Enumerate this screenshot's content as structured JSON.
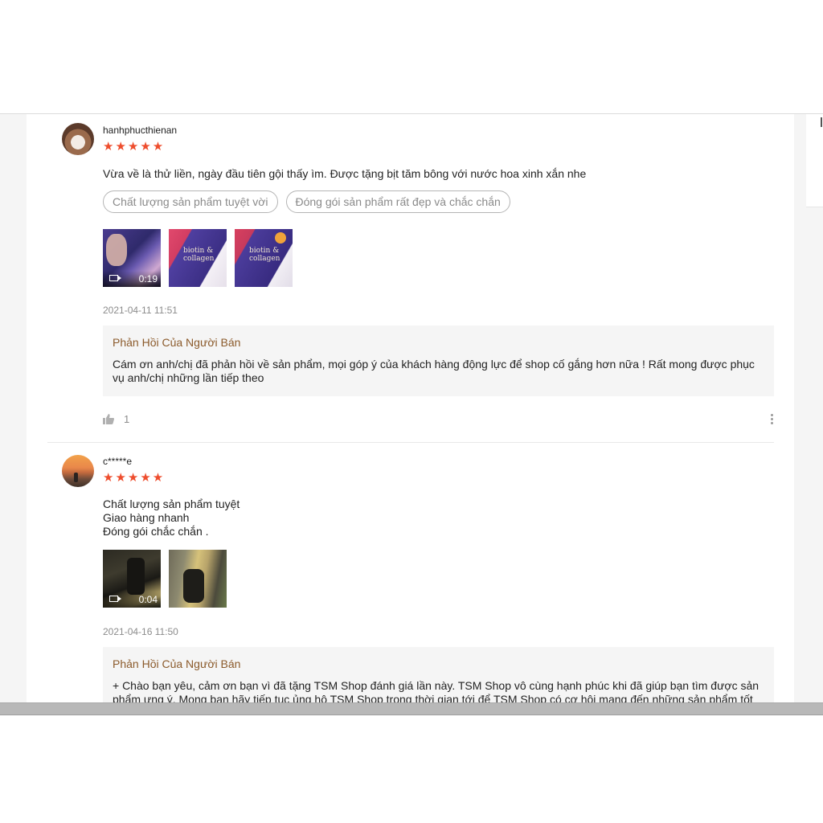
{
  "reviews": [
    {
      "username": "hanhphucthienan",
      "stars": "★★★★★",
      "comment": "Vừa về là thử liền, ngày đầu tiên gội thấy ìm. Được tặng bịt tăm bông với nước hoa xinh xắn nhe",
      "tags": [
        "Chất lượng sản phẩm tuyệt vời",
        "Đóng gói sản phẩm rất đẹp và chắc chắn"
      ],
      "video_duration": "0:19",
      "timestamp": "2021-04-11 11:51",
      "reply_title": "Phản Hồi Của Người Bán",
      "reply_body": "Cám ơn anh/chị đã phản hồi về sản phẩm, mọi góp ý của khách hàng động lực để shop cố gắng hơn nữa ! Rất mong được phục vụ anh/chị những lần tiếp theo",
      "likes": "1"
    },
    {
      "username": "c*****e",
      "stars": "★★★★★",
      "comment": "Chất lượng sản phẩm tuyệt\nGiao hàng nhanh\nĐóng gói chắc chắn .",
      "video_duration": "0:04",
      "timestamp": "2021-04-16 11:50",
      "reply_title": "Phản Hồi Của Người Bán",
      "reply_body": "+ Chào bạn yêu, cảm ơn bạn vì đã tặng TSM Shop đánh giá lần này. TSM Shop vô cùng hạnh phúc khi đã giúp bạn tìm được sản phẩm ưng ý. Mong bạn hãy tiếp tục ủng hộ TSM Shop trong thời gian tới để TSM Shop có cơ hội mang đến những sản phẩm tốt"
    }
  ],
  "colors": {
    "star": "#ee4d2d",
    "reply_title": "#8b5a2b"
  }
}
